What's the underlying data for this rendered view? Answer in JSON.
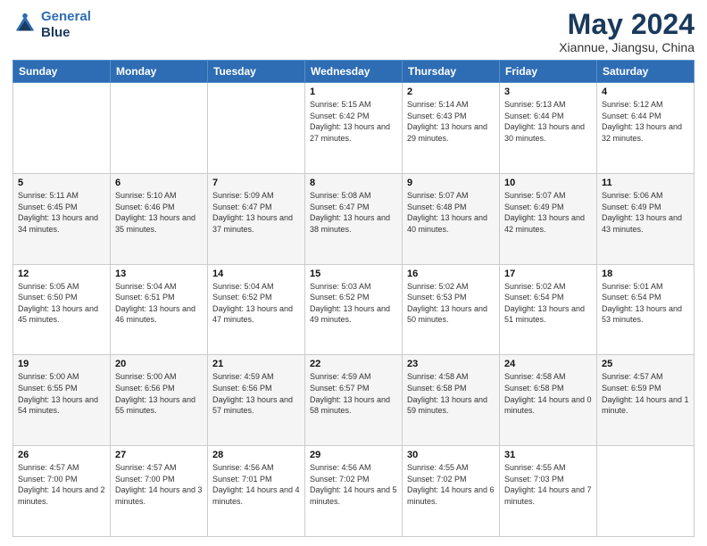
{
  "header": {
    "logo_line1": "General",
    "logo_line2": "Blue",
    "title": "May 2024",
    "subtitle": "Xiannue, Jiangsu, China"
  },
  "days_of_week": [
    "Sunday",
    "Monday",
    "Tuesday",
    "Wednesday",
    "Thursday",
    "Friday",
    "Saturday"
  ],
  "weeks": [
    [
      {
        "day": "",
        "sunrise": "",
        "sunset": "",
        "daylight": ""
      },
      {
        "day": "",
        "sunrise": "",
        "sunset": "",
        "daylight": ""
      },
      {
        "day": "",
        "sunrise": "",
        "sunset": "",
        "daylight": ""
      },
      {
        "day": "1",
        "sunrise": "Sunrise: 5:15 AM",
        "sunset": "Sunset: 6:42 PM",
        "daylight": "Daylight: 13 hours and 27 minutes."
      },
      {
        "day": "2",
        "sunrise": "Sunrise: 5:14 AM",
        "sunset": "Sunset: 6:43 PM",
        "daylight": "Daylight: 13 hours and 29 minutes."
      },
      {
        "day": "3",
        "sunrise": "Sunrise: 5:13 AM",
        "sunset": "Sunset: 6:44 PM",
        "daylight": "Daylight: 13 hours and 30 minutes."
      },
      {
        "day": "4",
        "sunrise": "Sunrise: 5:12 AM",
        "sunset": "Sunset: 6:44 PM",
        "daylight": "Daylight: 13 hours and 32 minutes."
      }
    ],
    [
      {
        "day": "5",
        "sunrise": "Sunrise: 5:11 AM",
        "sunset": "Sunset: 6:45 PM",
        "daylight": "Daylight: 13 hours and 34 minutes."
      },
      {
        "day": "6",
        "sunrise": "Sunrise: 5:10 AM",
        "sunset": "Sunset: 6:46 PM",
        "daylight": "Daylight: 13 hours and 35 minutes."
      },
      {
        "day": "7",
        "sunrise": "Sunrise: 5:09 AM",
        "sunset": "Sunset: 6:47 PM",
        "daylight": "Daylight: 13 hours and 37 minutes."
      },
      {
        "day": "8",
        "sunrise": "Sunrise: 5:08 AM",
        "sunset": "Sunset: 6:47 PM",
        "daylight": "Daylight: 13 hours and 38 minutes."
      },
      {
        "day": "9",
        "sunrise": "Sunrise: 5:07 AM",
        "sunset": "Sunset: 6:48 PM",
        "daylight": "Daylight: 13 hours and 40 minutes."
      },
      {
        "day": "10",
        "sunrise": "Sunrise: 5:07 AM",
        "sunset": "Sunset: 6:49 PM",
        "daylight": "Daylight: 13 hours and 42 minutes."
      },
      {
        "day": "11",
        "sunrise": "Sunrise: 5:06 AM",
        "sunset": "Sunset: 6:49 PM",
        "daylight": "Daylight: 13 hours and 43 minutes."
      }
    ],
    [
      {
        "day": "12",
        "sunrise": "Sunrise: 5:05 AM",
        "sunset": "Sunset: 6:50 PM",
        "daylight": "Daylight: 13 hours and 45 minutes."
      },
      {
        "day": "13",
        "sunrise": "Sunrise: 5:04 AM",
        "sunset": "Sunset: 6:51 PM",
        "daylight": "Daylight: 13 hours and 46 minutes."
      },
      {
        "day": "14",
        "sunrise": "Sunrise: 5:04 AM",
        "sunset": "Sunset: 6:52 PM",
        "daylight": "Daylight: 13 hours and 47 minutes."
      },
      {
        "day": "15",
        "sunrise": "Sunrise: 5:03 AM",
        "sunset": "Sunset: 6:52 PM",
        "daylight": "Daylight: 13 hours and 49 minutes."
      },
      {
        "day": "16",
        "sunrise": "Sunrise: 5:02 AM",
        "sunset": "Sunset: 6:53 PM",
        "daylight": "Daylight: 13 hours and 50 minutes."
      },
      {
        "day": "17",
        "sunrise": "Sunrise: 5:02 AM",
        "sunset": "Sunset: 6:54 PM",
        "daylight": "Daylight: 13 hours and 51 minutes."
      },
      {
        "day": "18",
        "sunrise": "Sunrise: 5:01 AM",
        "sunset": "Sunset: 6:54 PM",
        "daylight": "Daylight: 13 hours and 53 minutes."
      }
    ],
    [
      {
        "day": "19",
        "sunrise": "Sunrise: 5:00 AM",
        "sunset": "Sunset: 6:55 PM",
        "daylight": "Daylight: 13 hours and 54 minutes."
      },
      {
        "day": "20",
        "sunrise": "Sunrise: 5:00 AM",
        "sunset": "Sunset: 6:56 PM",
        "daylight": "Daylight: 13 hours and 55 minutes."
      },
      {
        "day": "21",
        "sunrise": "Sunrise: 4:59 AM",
        "sunset": "Sunset: 6:56 PM",
        "daylight": "Daylight: 13 hours and 57 minutes."
      },
      {
        "day": "22",
        "sunrise": "Sunrise: 4:59 AM",
        "sunset": "Sunset: 6:57 PM",
        "daylight": "Daylight: 13 hours and 58 minutes."
      },
      {
        "day": "23",
        "sunrise": "Sunrise: 4:58 AM",
        "sunset": "Sunset: 6:58 PM",
        "daylight": "Daylight: 13 hours and 59 minutes."
      },
      {
        "day": "24",
        "sunrise": "Sunrise: 4:58 AM",
        "sunset": "Sunset: 6:58 PM",
        "daylight": "Daylight: 14 hours and 0 minutes."
      },
      {
        "day": "25",
        "sunrise": "Sunrise: 4:57 AM",
        "sunset": "Sunset: 6:59 PM",
        "daylight": "Daylight: 14 hours and 1 minute."
      }
    ],
    [
      {
        "day": "26",
        "sunrise": "Sunrise: 4:57 AM",
        "sunset": "Sunset: 7:00 PM",
        "daylight": "Daylight: 14 hours and 2 minutes."
      },
      {
        "day": "27",
        "sunrise": "Sunrise: 4:57 AM",
        "sunset": "Sunset: 7:00 PM",
        "daylight": "Daylight: 14 hours and 3 minutes."
      },
      {
        "day": "28",
        "sunrise": "Sunrise: 4:56 AM",
        "sunset": "Sunset: 7:01 PM",
        "daylight": "Daylight: 14 hours and 4 minutes."
      },
      {
        "day": "29",
        "sunrise": "Sunrise: 4:56 AM",
        "sunset": "Sunset: 7:02 PM",
        "daylight": "Daylight: 14 hours and 5 minutes."
      },
      {
        "day": "30",
        "sunrise": "Sunrise: 4:55 AM",
        "sunset": "Sunset: 7:02 PM",
        "daylight": "Daylight: 14 hours and 6 minutes."
      },
      {
        "day": "31",
        "sunrise": "Sunrise: 4:55 AM",
        "sunset": "Sunset: 7:03 PM",
        "daylight": "Daylight: 14 hours and 7 minutes."
      },
      {
        "day": "",
        "sunrise": "",
        "sunset": "",
        "daylight": ""
      }
    ]
  ]
}
